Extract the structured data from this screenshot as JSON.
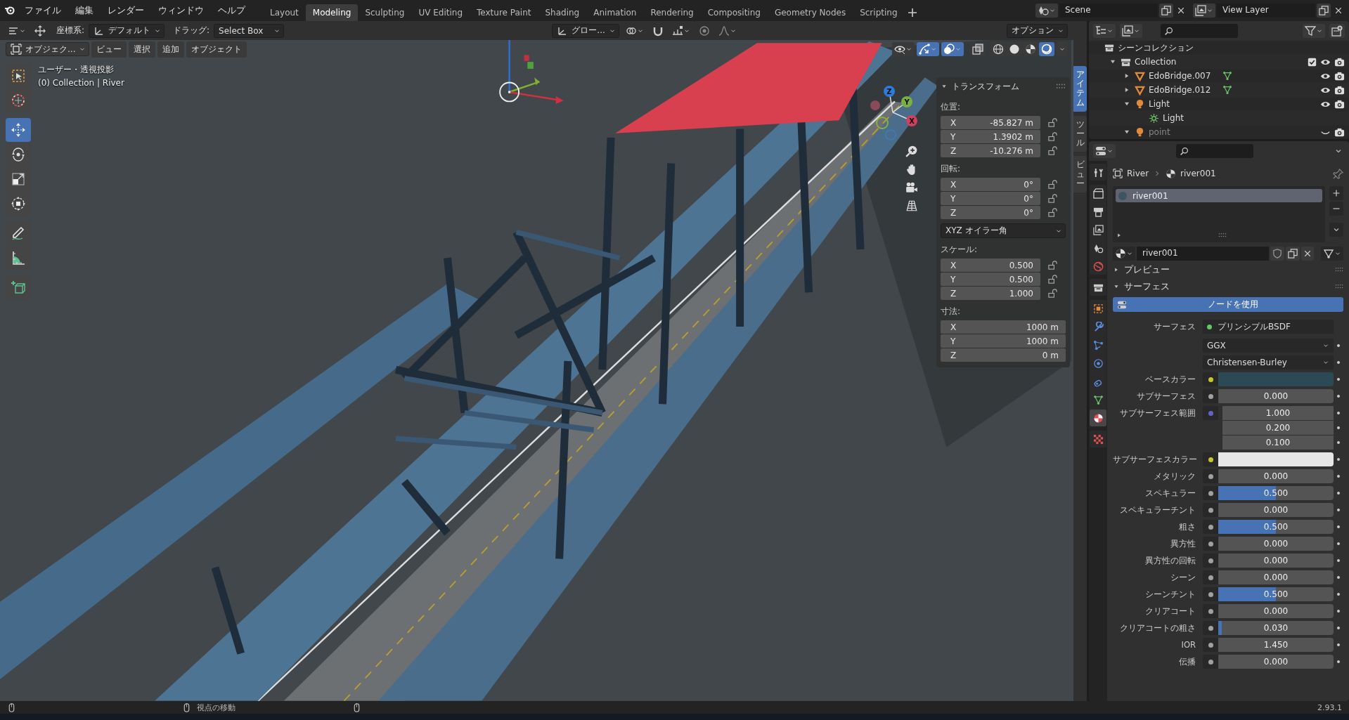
{
  "menu": [
    "ファイル",
    "編集",
    "レンダー",
    "ウィンドウ",
    "ヘルプ"
  ],
  "workspaces": [
    {
      "label": "Layout",
      "selected": false
    },
    {
      "label": "Modeling",
      "selected": true
    },
    {
      "label": "Sculpting",
      "selected": false
    },
    {
      "label": "UV Editing",
      "selected": false
    },
    {
      "label": "Texture Paint",
      "selected": false
    },
    {
      "label": "Shading",
      "selected": false
    },
    {
      "label": "Animation",
      "selected": false
    },
    {
      "label": "Rendering",
      "selected": false
    },
    {
      "label": "Compositing",
      "selected": false
    },
    {
      "label": "Geometry Nodes",
      "selected": false
    },
    {
      "label": "Scripting",
      "selected": false
    }
  ],
  "scene": "Scene",
  "view_layer": "View Layer",
  "viewport_header": {
    "coord_label": "座標系:",
    "coord_value": "デフォルト",
    "drag_label": "ドラッグ:",
    "drag_value": "Select Box",
    "orientation": "グロー...",
    "options": "オプション",
    "mode": "オブジェク...",
    "menus": [
      "ビュー",
      "選択",
      "追加",
      "オブジェクト"
    ]
  },
  "shading": [
    {
      "kind": "wireframe",
      "selected": false
    },
    {
      "kind": "solid",
      "selected": false
    },
    {
      "kind": "material",
      "selected": false
    },
    {
      "kind": "rendered",
      "selected": true
    }
  ],
  "viewport": {
    "view_name": "ユーザー・透視投影",
    "context": "(0) Collection | River"
  },
  "tool_groups": [
    [
      {
        "kind": "select",
        "selected": false
      },
      {
        "kind": "cursor",
        "selected": false
      }
    ],
    [
      {
        "kind": "move",
        "selected": true
      },
      {
        "kind": "rotate",
        "selected": false
      },
      {
        "kind": "scale",
        "selected": false
      },
      {
        "kind": "transform",
        "selected": false
      }
    ],
    [
      {
        "kind": "annotate",
        "selected": false
      },
      {
        "kind": "measure",
        "selected": false
      }
    ],
    [
      {
        "kind": "add_cube",
        "selected": false
      }
    ]
  ],
  "nav_gizmo": {
    "x": "X",
    "y": "Y",
    "z": "Z"
  },
  "transform_panel": {
    "title": "トランスフォーム",
    "sections": [
      {
        "kind": "vector",
        "label": "位置:",
        "locks": true,
        "fields": [
          {
            "axis": "X",
            "value": "-85.827 m"
          },
          {
            "axis": "Y",
            "value": "1.3902 m"
          },
          {
            "axis": "Z",
            "value": "-10.276 m"
          }
        ]
      },
      {
        "kind": "vector",
        "label": "回転:",
        "locks": true,
        "fields": [
          {
            "axis": "X",
            "value": "0°"
          },
          {
            "axis": "Y",
            "value": "0°"
          },
          {
            "axis": "Z",
            "value": "0°"
          }
        ]
      },
      {
        "kind": "dropdown",
        "value": "XYZ オイラー角"
      },
      {
        "kind": "vector",
        "label": "スケール:",
        "locks": true,
        "fields": [
          {
            "axis": "X",
            "value": "0.500"
          },
          {
            "axis": "Y",
            "value": "0.500"
          },
          {
            "axis": "Z",
            "value": "1.000"
          }
        ]
      },
      {
        "kind": "vector",
        "label": "寸法:",
        "locks": false,
        "fields": [
          {
            "axis": "X",
            "value": "1000 m"
          },
          {
            "axis": "Y",
            "value": "1000 m"
          },
          {
            "axis": "Z",
            "value": "0 m"
          }
        ]
      }
    ]
  },
  "side_tabs": [
    {
      "label": "アイテム",
      "selected": true
    },
    {
      "label": "ツール",
      "selected": false
    },
    {
      "label": "ビュー",
      "selected": false
    }
  ],
  "outliner": {
    "root": "シーンコレクション",
    "items": [
      {
        "name": "Collection",
        "kind": "collection",
        "expanded": true,
        "checked": true,
        "visible": true,
        "children": [
          {
            "name": "EdoBridge.007",
            "kind": "mesh",
            "expanded": false,
            "visible": true
          },
          {
            "name": "EdoBridge.012",
            "kind": "mesh",
            "expanded": false,
            "visible": true
          },
          {
            "name": "Light",
            "kind": "light",
            "expanded": true,
            "visible": true,
            "children": [
              {
                "name": "Light",
                "kind": "light_data"
              }
            ]
          },
          {
            "name": "point",
            "kind": "light",
            "expanded": true,
            "visible": false
          }
        ]
      }
    ]
  },
  "property_tabs": [
    [
      {
        "kind": "tool",
        "selected": false
      }
    ],
    [
      {
        "kind": "render",
        "selected": false
      },
      {
        "kind": "output",
        "selected": false
      },
      {
        "kind": "view_layer",
        "selected": false
      },
      {
        "kind": "scene",
        "selected": false
      },
      {
        "kind": "world",
        "selected": false
      }
    ],
    [
      {
        "kind": "collection",
        "selected": false
      }
    ],
    [
      {
        "kind": "object",
        "selected": false
      },
      {
        "kind": "modifier",
        "selected": false
      },
      {
        "kind": "particles",
        "selected": false
      },
      {
        "kind": "physics",
        "selected": false
      },
      {
        "kind": "constraints",
        "selected": false
      },
      {
        "kind": "data",
        "selected": false
      },
      {
        "kind": "material",
        "selected": true
      }
    ],
    [
      {
        "kind": "texture",
        "selected": false
      }
    ]
  ],
  "properties": {
    "breadcrumb": [
      "River",
      "river001"
    ],
    "slots": [
      {
        "name": "river001",
        "selected": true
      }
    ],
    "material": "river001",
    "panels": [
      {
        "title": "プレビュー",
        "expanded": false
      },
      {
        "title": "サーフェス",
        "expanded": true
      }
    ],
    "use_nodes": "ノードを使用",
    "surface_label": "サーフェス",
    "surface_shader": "プリンシプルBSDF",
    "surface_socket": {
      "color": "#63c763"
    },
    "rows": [
      {
        "kind": "dropdown",
        "value": "GGX"
      },
      {
        "kind": "dropdown",
        "value": "Christensen-Burley"
      },
      {
        "kind": "color",
        "label": "ベースカラー",
        "color": "#c7c729",
        "swatch": {
          "color": "#2c4a55"
        }
      },
      {
        "kind": "slider",
        "label": "サブサーフェス",
        "color": "#a1a1a1",
        "value": "0.000",
        "level": 0
      },
      {
        "kind": "vector",
        "label": "サブサーフェス範囲",
        "color": "#6363c7",
        "values": [
          "1.000",
          "0.200",
          "0.100"
        ]
      },
      {
        "kind": "color",
        "label": "サブサーフェスカラー",
        "color": "#c7c729",
        "swatch": {
          "color": "#e6e6e6"
        }
      },
      {
        "kind": "slider",
        "label": "メタリック",
        "color": "#a1a1a1",
        "value": "0.000",
        "level": 0
      },
      {
        "kind": "slider",
        "label": "スペキュラー",
        "color": "#a1a1a1",
        "value": "0.500",
        "level": 0.5
      },
      {
        "kind": "slider",
        "label": "スペキュラーチント",
        "color": "#a1a1a1",
        "value": "0.000",
        "level": 0
      },
      {
        "kind": "slider",
        "label": "粗さ",
        "color": "#a1a1a1",
        "value": "0.500",
        "level": 0.5
      },
      {
        "kind": "slider",
        "label": "異方性",
        "color": "#a1a1a1",
        "value": "0.000",
        "level": 0
      },
      {
        "kind": "slider",
        "label": "異方性の回転",
        "color": "#a1a1a1",
        "value": "0.000",
        "level": 0
      },
      {
        "kind": "slider",
        "label": "シーン",
        "color": "#a1a1a1",
        "value": "0.000",
        "level": 0
      },
      {
        "kind": "slider",
        "label": "シーンチント",
        "color": "#a1a1a1",
        "value": "0.500",
        "level": 0.5
      },
      {
        "kind": "slider",
        "label": "クリアコート",
        "color": "#a1a1a1",
        "value": "0.000",
        "level": 0
      },
      {
        "kind": "slider",
        "label": "クリアコートの粗さ",
        "color": "#a1a1a1",
        "value": "0.030",
        "level": 0.03
      },
      {
        "kind": "number",
        "label": "IOR",
        "color": "#a1a1a1",
        "value": "1.450"
      },
      {
        "kind": "slider",
        "label": "伝播",
        "color": "#a1a1a1",
        "value": "0.000",
        "level": 0
      }
    ]
  },
  "status_bar": {
    "hints": [
      "視点の移動"
    ],
    "version": "2.93.1"
  }
}
